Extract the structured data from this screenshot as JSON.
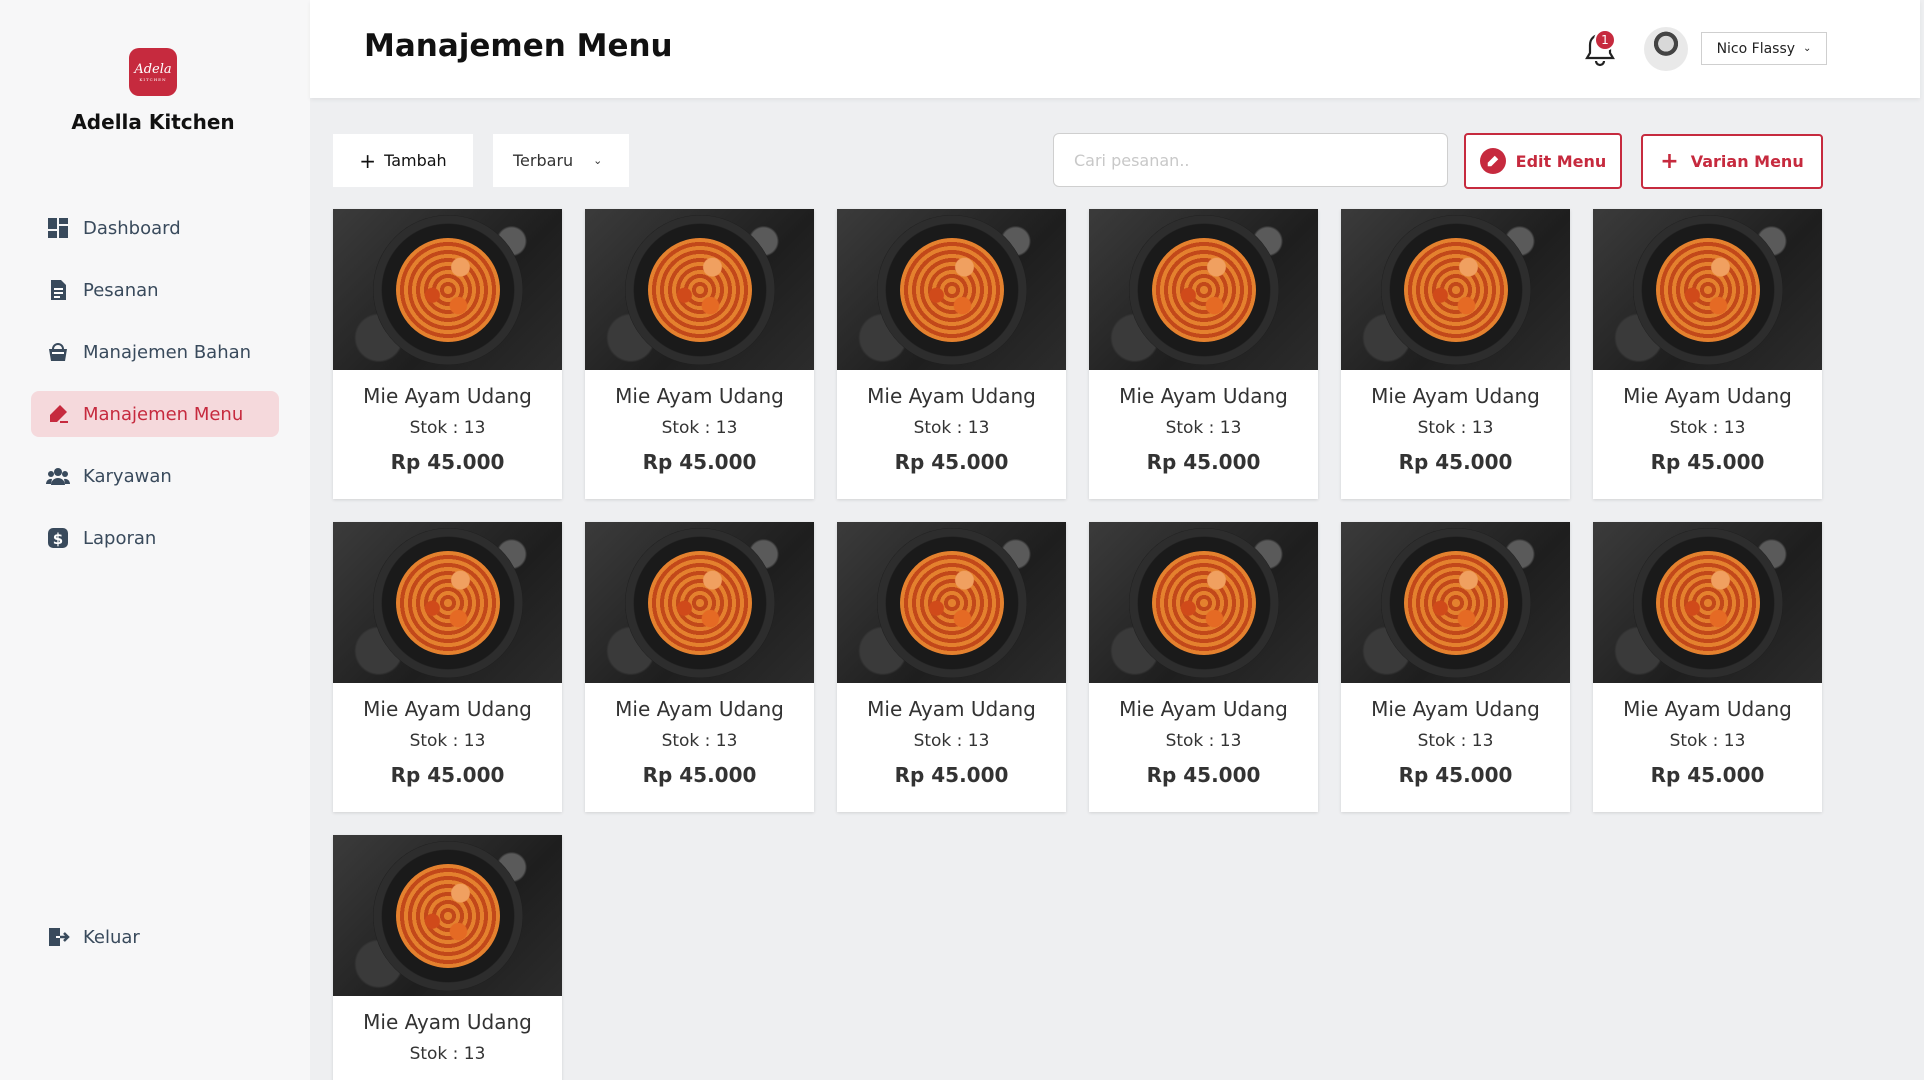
{
  "brand": {
    "logo_text": "Adela",
    "logo_sub": "KITCHEN",
    "name": "Adella Kitchen"
  },
  "sidebar": {
    "items": [
      {
        "label": "Dashboard",
        "icon": "dashboard-icon",
        "active": false
      },
      {
        "label": "Pesanan",
        "icon": "order-icon",
        "active": false
      },
      {
        "label": "Manajemen Bahan",
        "icon": "basket-icon",
        "active": false
      },
      {
        "label": "Manajemen Menu",
        "icon": "menu-edit-icon",
        "active": true
      },
      {
        "label": "Karyawan",
        "icon": "users-icon",
        "active": false
      },
      {
        "label": "Laporan",
        "icon": "dollar-icon",
        "active": false
      }
    ],
    "logout": {
      "label": "Keluar",
      "icon": "logout-icon"
    }
  },
  "header": {
    "title": "Manajemen Menu",
    "notification_count": "1",
    "user_name": "Nico Flassy"
  },
  "toolbar": {
    "add_label": "Tambah",
    "sort_value": "Terbaru",
    "search_placeholder": "Cari pesanan..",
    "edit_label": "Edit Menu",
    "variant_label": "Varian Menu"
  },
  "menu_items": [
    {
      "name": "Mie Ayam Udang",
      "stock": "Stok : 13",
      "price": "Rp 45.000"
    },
    {
      "name": "Mie Ayam Udang",
      "stock": "Stok : 13",
      "price": "Rp 45.000"
    },
    {
      "name": "Mie Ayam Udang",
      "stock": "Stok : 13",
      "price": "Rp 45.000"
    },
    {
      "name": "Mie Ayam Udang",
      "stock": "Stok : 13",
      "price": "Rp 45.000"
    },
    {
      "name": "Mie Ayam Udang",
      "stock": "Stok : 13",
      "price": "Rp 45.000"
    },
    {
      "name": "Mie Ayam Udang",
      "stock": "Stok : 13",
      "price": "Rp 45.000"
    },
    {
      "name": "Mie Ayam Udang",
      "stock": "Stok : 13",
      "price": "Rp 45.000"
    },
    {
      "name": "Mie Ayam Udang",
      "stock": "Stok : 13",
      "price": "Rp 45.000"
    },
    {
      "name": "Mie Ayam Udang",
      "stock": "Stok : 13",
      "price": "Rp 45.000"
    },
    {
      "name": "Mie Ayam Udang",
      "stock": "Stok : 13",
      "price": "Rp 45.000"
    },
    {
      "name": "Mie Ayam Udang",
      "stock": "Stok : 13",
      "price": "Rp 45.000"
    },
    {
      "name": "Mie Ayam Udang",
      "stock": "Stok : 13",
      "price": "Rp 45.000"
    },
    {
      "name": "Mie Ayam Udang",
      "stock": "Stok : 13",
      "price": ""
    }
  ],
  "colors": {
    "accent": "#c62a3e",
    "active_bg": "#f5d9dc",
    "background": "#eeeff1"
  }
}
